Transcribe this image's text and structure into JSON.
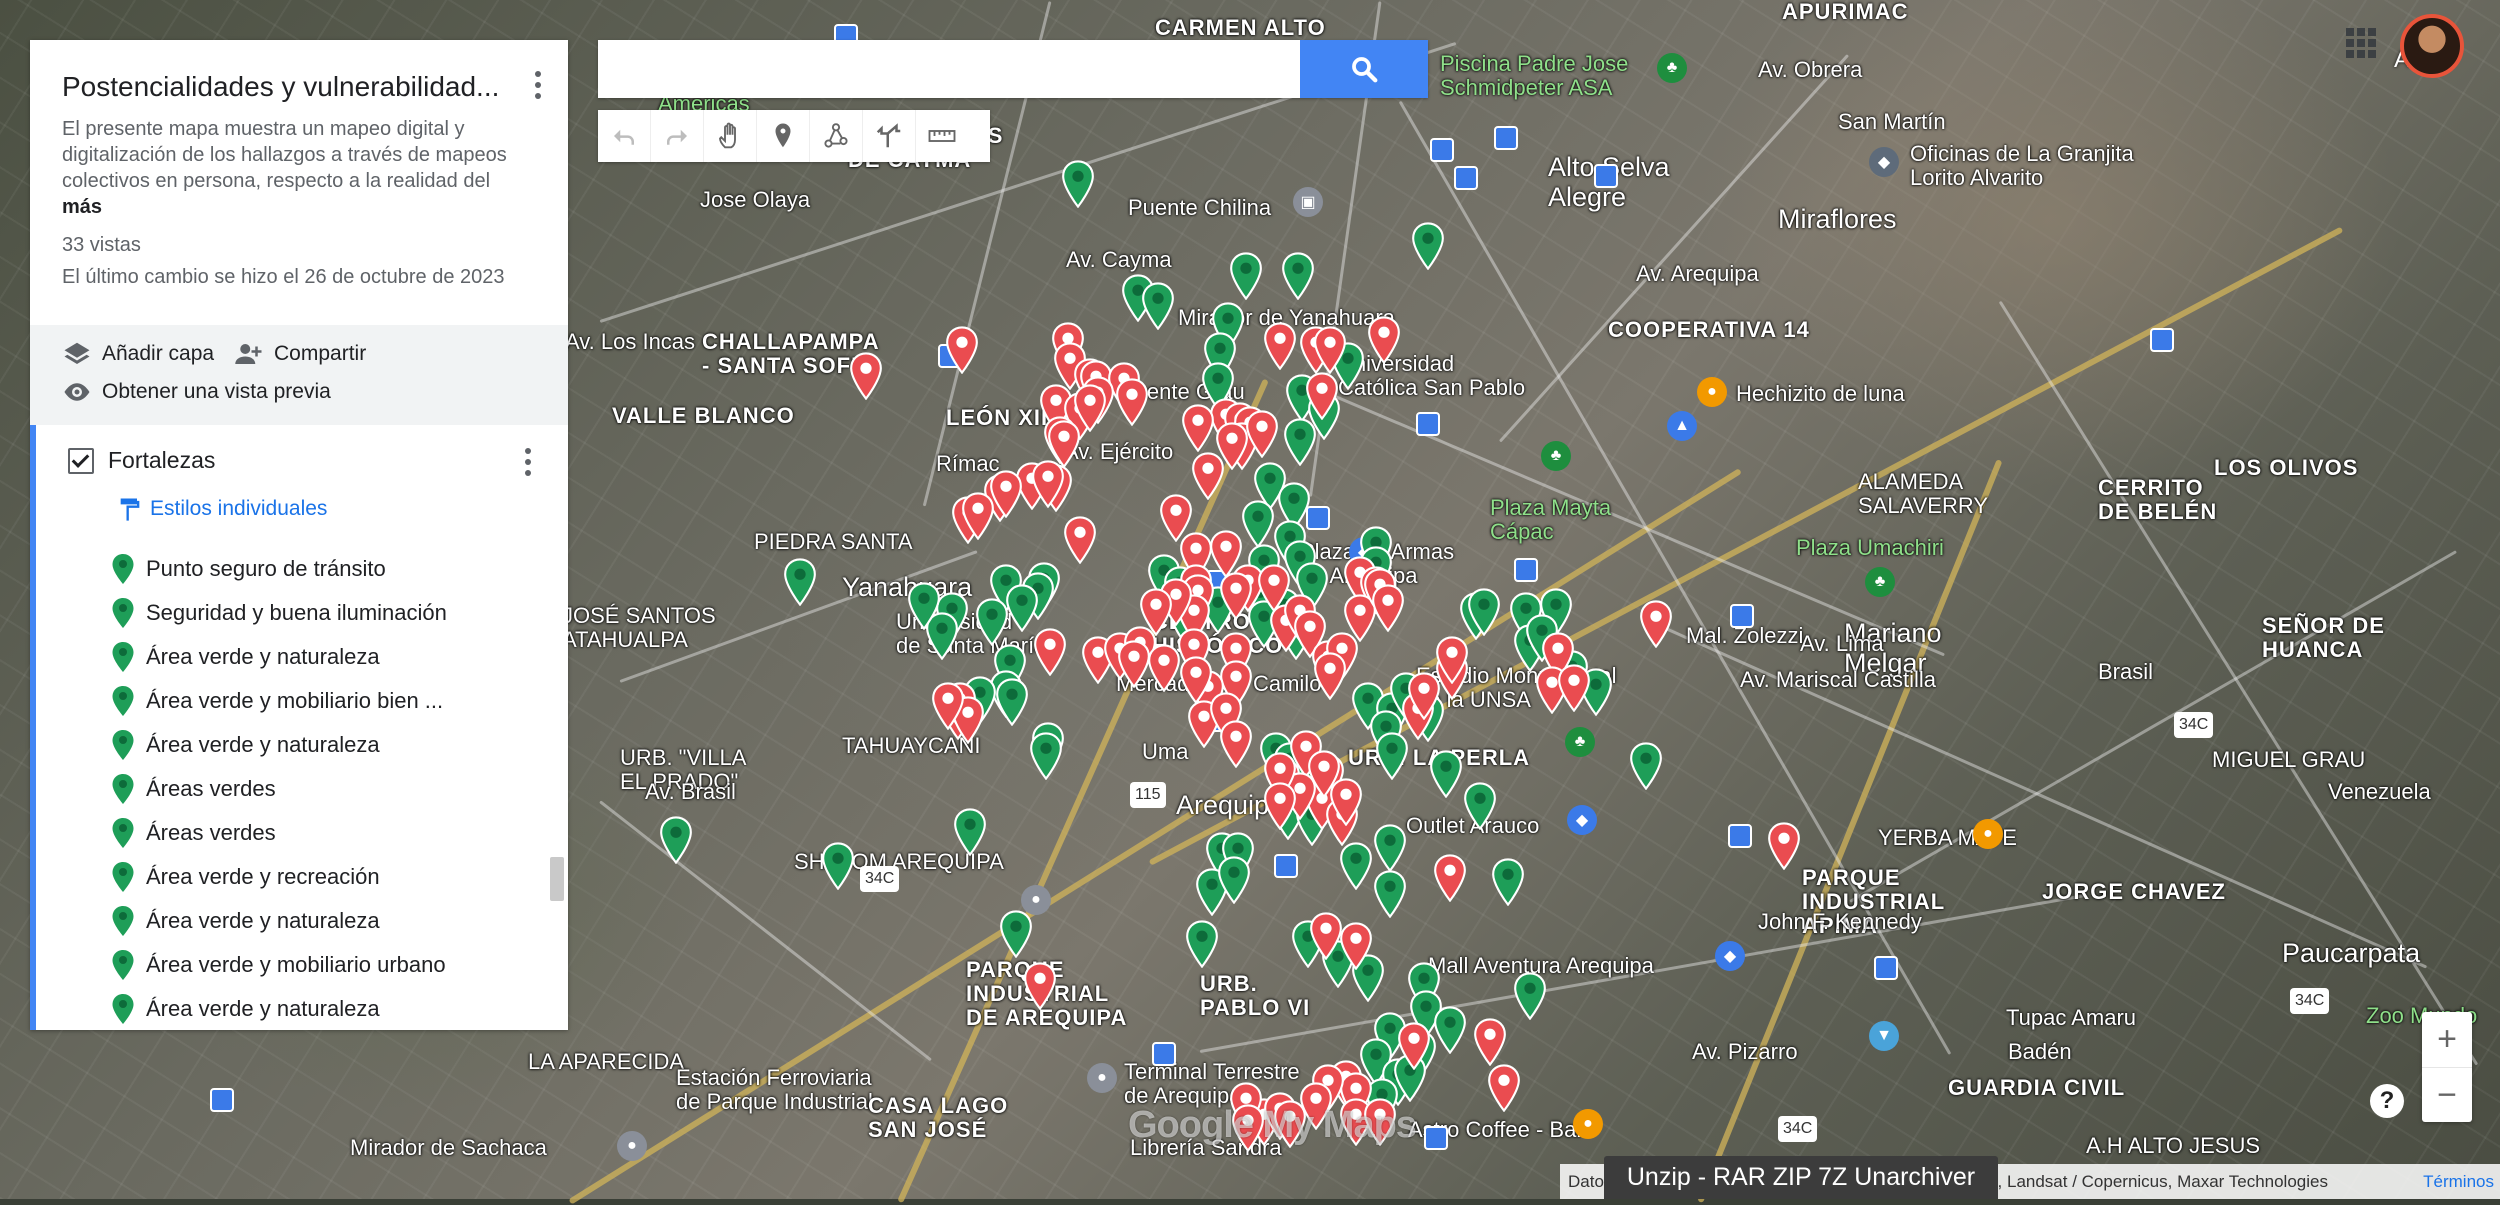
{
  "panel": {
    "title": "Postencialidades y vulnerabilidad...",
    "description": "El presente mapa muestra un mapeo digital y digitalización de los hallazgos a través de mapeos colectivos en persona, respecto a la realidad del",
    "more": "más",
    "views": "33 vistas",
    "last_change": "El último cambio se hizo el 26 de octubre de 2023",
    "actions": {
      "add_layer": "Añadir capa",
      "share": "Compartir",
      "preview": "Obtener una vista previa"
    },
    "layer": {
      "name": "Fortalezas",
      "styles_label": "Estilos individuales",
      "items": [
        "Punto seguro de tránsito",
        "Seguridad y buena iluminación",
        "Área verde y naturaleza",
        "Área verde y mobiliario bien ...",
        "Área verde y naturaleza",
        "Áreas verdes",
        "Áreas verdes",
        "Área verde y recreación",
        "Área verde y naturaleza",
        "Área verde y mobiliario urbano",
        "Área verde y naturaleza"
      ]
    }
  },
  "search": {
    "placeholder": ""
  },
  "map": {
    "places": [
      "CARMEN ALTO",
      "APURIMAC",
      "Piscina Padre Jose\nSchmidpeter ASA",
      "Alto Selva\nAlegre",
      "Oficinas de La Granjita\nLorito Alvarito",
      "Miraflores",
      "Puente Chilina",
      "COOPERATIVA 14",
      "Hechizito de luna",
      "CHALLAPAMPA\n- SANTA SOFIA",
      "VALLE BLANCO",
      "LEÓN XIII",
      "Mirador de Yanahuara",
      "Universidad\nCatólica San Pablo",
      "Puente Grau",
      "ALAMEDA\nSALAVERRY",
      "CERRITO\nDE BELÉN",
      "LOS OLIVOS",
      "Plaza Mayta\nCápac",
      "Plaza Umachiri",
      "PIEDRA SANTA",
      "Yanahuara",
      "Plaza de Armas\nde Arequipa",
      "CENTRO\nHISTÓRICO",
      "Mariano\nMelgar",
      "SEÑOR DE\nHUANCA",
      "JOSÉ SANTOS\nATAHUALPA",
      "Universidad\nde Santa María",
      "Mercado San Camilo",
      "Estadio Monumental\nde la UNSA",
      "TAHUAYCANI",
      "URB. \"VILLA\nEL PRADO\"",
      "URB. LA PERLA",
      "MIGUEL GRAU",
      "Arequipa",
      "Outlet Arauco",
      "YERBA MATE",
      "PARQUE\nINDUSTRIAL\nAPIMA",
      "JORGE CHAVEZ",
      "SHALOM AREQUIPA",
      "PARQUE\nINDUSTRIAL\nDE AREQUIPA",
      "URB.\nPABLO VI",
      "Mall Aventura Arequipa",
      "Paucarpata",
      "Zoo Mundo",
      "LA APARECIDA",
      "Estación Ferroviaria\nde Parque Industrial",
      "CASA LAGO\nSAN JOSÉ",
      "Terminal Terrestre\nde Arequipa",
      "Badén",
      "GUARDIA CIVIL",
      "Mirador de Sachaca",
      "Librería Sandra",
      "Astro Coffee - Bar",
      "A.H ALTO JESUS",
      "LOS CEDROS\nDE CAYMA",
      "Av. Cayma",
      "Av. Ejército",
      "Av. Arequipa",
      "Av. Lima",
      "Av. Brasil",
      "Rímac",
      "Uma",
      "Mal. Zolezzi",
      "Av. Mariscal Castilla",
      "John F. Kennedy",
      "Av. Pizarro",
      "Tupac Amaru",
      "Venezuela",
      "Av. Los Incas",
      "Jose Olaya",
      "Av. Obrera",
      "San Martín",
      "Brasil",
      "Americas"
    ],
    "route_shields": [
      "115",
      "34C",
      "34C",
      "34C",
      "34C"
    ],
    "legend_colors": {
      "strength": "#1e9e58",
      "vulnerability": "#ea4c50"
    }
  },
  "brand": "Google My Maps",
  "attribution": "Datos del mapa ©2023 Google Imágenes ©2023 / Airbus, Landsat / Copernicus, Maxar Technologies",
  "attribution_terms": "Términos",
  "toast": "Unzip - RAR ZIP 7Z Unarchiver",
  "user": {
    "label": "Asoc"
  },
  "zoom": {
    "in": "+",
    "out": "−"
  },
  "help": "?"
}
